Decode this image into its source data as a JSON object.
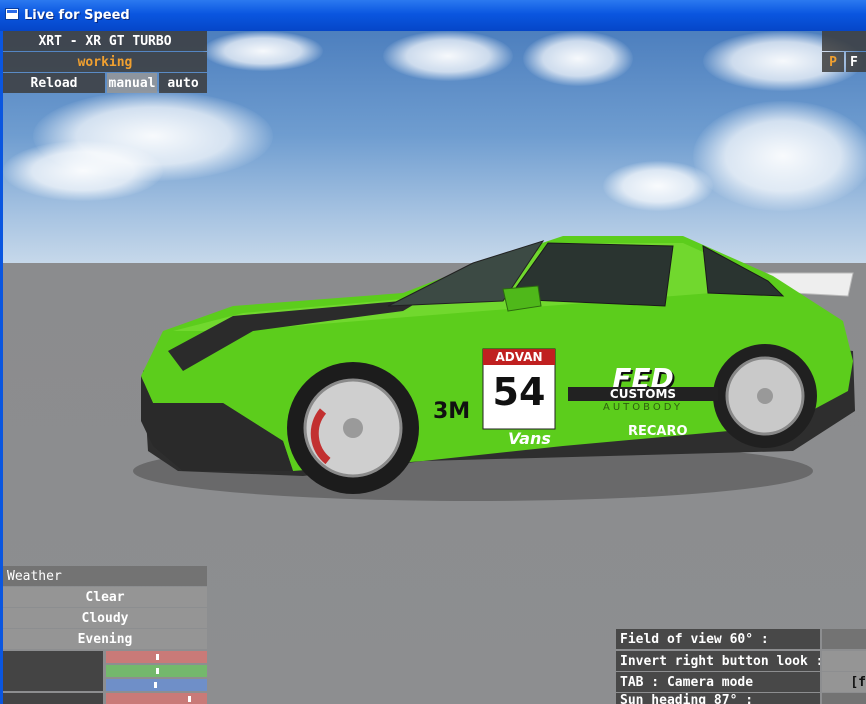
{
  "window": {
    "title": "Live for Speed"
  },
  "car_panel": {
    "car_name": "XRT - XR GT TURBO",
    "status": "working",
    "reload": "Reload",
    "manual": "manual",
    "auto": "auto"
  },
  "top_right": {
    "p_label": "P",
    "partial_label": "F"
  },
  "weather": {
    "heading": "Weather",
    "options": [
      "Clear",
      "Cloudy",
      "Evening"
    ],
    "sliders": [
      {
        "color": "#c97a78",
        "level": 0.3
      },
      {
        "color": "#74b86c",
        "level": 0.3
      },
      {
        "color": "#6f8fc8",
        "level": 0.3
      },
      {
        "color": "#c97a78",
        "level": 0.8
      }
    ]
  },
  "view_options": {
    "field_of_view": "Field of view 60° :",
    "invert_look": "Invert right button look :",
    "camera_mode": "TAB : Camera mode",
    "camera_mode_value": "[f",
    "sun_heading": "Sun heading 87° :"
  },
  "car_livery": {
    "race_number": "54",
    "sponsor_advan": "ADVAN",
    "sponsor_3m": "3M",
    "sponsor_fed": "FED",
    "sponsor_customs": "CUSTOMS",
    "sponsor_autobody": "AUTOBODY",
    "sponsor_vans": "Vans",
    "sponsor_recaro": "RECARO",
    "colors": {
      "body": "#5ccd1c",
      "dark": "#2e2e2e",
      "wheel": "#c8c8c8"
    }
  }
}
